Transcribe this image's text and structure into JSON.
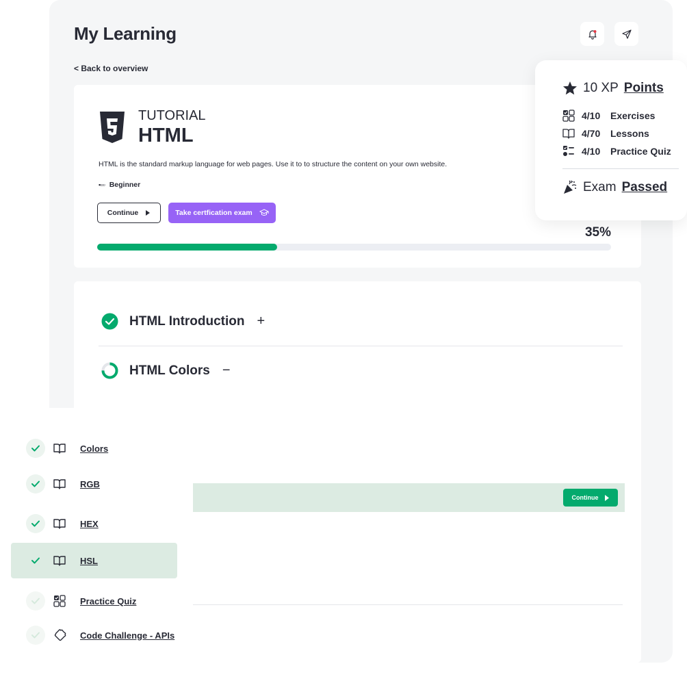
{
  "page": {
    "title": "My Learning",
    "back_link": "< Back to overview"
  },
  "icons": {
    "notification": "bell-icon",
    "share": "send-icon"
  },
  "course": {
    "label": "TUTORIAL",
    "title": "HTML",
    "description": "HTML is the standard markup language for web pages. Use it to to structure the content on your own website.",
    "level_indicator": "▪▫▫▫",
    "level": "Beginner",
    "continue_label": "Continue",
    "exam_label": "Take certfication exam",
    "progress_percent": 35,
    "progress_text": "35%"
  },
  "modules": [
    {
      "title": "HTML Introduction",
      "toggle": "+",
      "status": "complete"
    },
    {
      "title": "HTML Colors",
      "toggle": "−",
      "status": "in-progress"
    }
  ],
  "current_lesson": {
    "continue_label": "Continue"
  },
  "stats": {
    "xp_value": "10 XP",
    "xp_label": "Points",
    "exercises_count": "4/10",
    "exercises_label": "Exercises",
    "lessons_count": "4/70",
    "lessons_label": "Lessons",
    "quiz_count": "4/10",
    "quiz_label": "Practice Quiz",
    "exam_prefix": "Exam",
    "exam_status": "Passed"
  },
  "lessons": [
    {
      "label": "Colors",
      "icon": "book-icon",
      "done": true,
      "active": false
    },
    {
      "label": "RGB",
      "icon": "book-icon",
      "done": true,
      "active": false
    },
    {
      "label": "HEX",
      "icon": "book-icon",
      "done": true,
      "active": false
    },
    {
      "label": "HSL",
      "icon": "book-icon",
      "done": true,
      "active": true
    },
    {
      "label": "Practice Quiz",
      "icon": "quiz-icon",
      "done": false,
      "active": false
    },
    {
      "label": "Code Challenge - APIs",
      "icon": "puzzle-icon",
      "done": false,
      "active": false
    }
  ],
  "colors": {
    "accent": "#04aa6d",
    "exam": "#9763f6",
    "active_bg": "#dcebe2",
    "text": "#282a35"
  }
}
